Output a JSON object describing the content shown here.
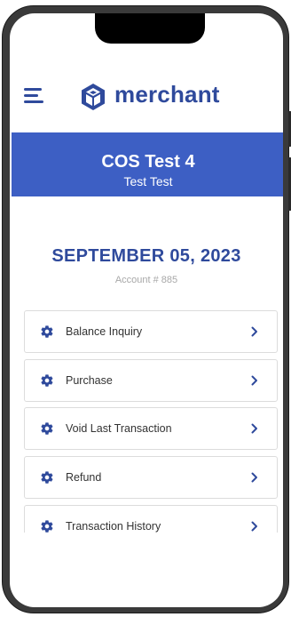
{
  "header": {
    "logo_text": "merchant",
    "menu_icon": "hamburger-icon",
    "logo_icon": "merchant-logo-icon"
  },
  "banner": {
    "title": "COS Test 4",
    "subtitle": "Test Test"
  },
  "info": {
    "date": "SEPTEMBER 05, 2023",
    "account": "Account # 885"
  },
  "menu": {
    "items": [
      {
        "label": "Balance Inquiry",
        "icon": "gear-icon"
      },
      {
        "label": "Purchase",
        "icon": "gear-icon"
      },
      {
        "label": "Void Last Transaction",
        "icon": "gear-icon"
      },
      {
        "label": "Refund",
        "icon": "gear-icon"
      },
      {
        "label": "Transaction History",
        "icon": "gear-icon"
      }
    ]
  },
  "colors": {
    "brand": "#2f4a9c",
    "banner": "#3d5fc4",
    "muted_text": "#a8a8a8"
  }
}
